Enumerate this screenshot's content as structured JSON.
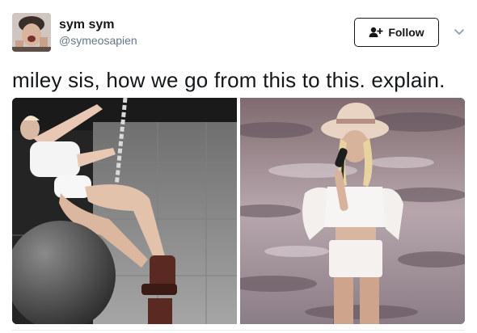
{
  "user": {
    "display_name": "sym sym",
    "handle": "@symeosapien"
  },
  "follow_button": {
    "label": "Follow"
  },
  "tweet": {
    "text": "miley sis, how we go from this to this. explain."
  },
  "media": {
    "count": 2
  },
  "colors": {
    "text_primary": "#14171a",
    "text_secondary": "#657786",
    "border": "#14171a"
  },
  "icons": [
    "add-person-icon",
    "chevron-down-icon"
  ]
}
